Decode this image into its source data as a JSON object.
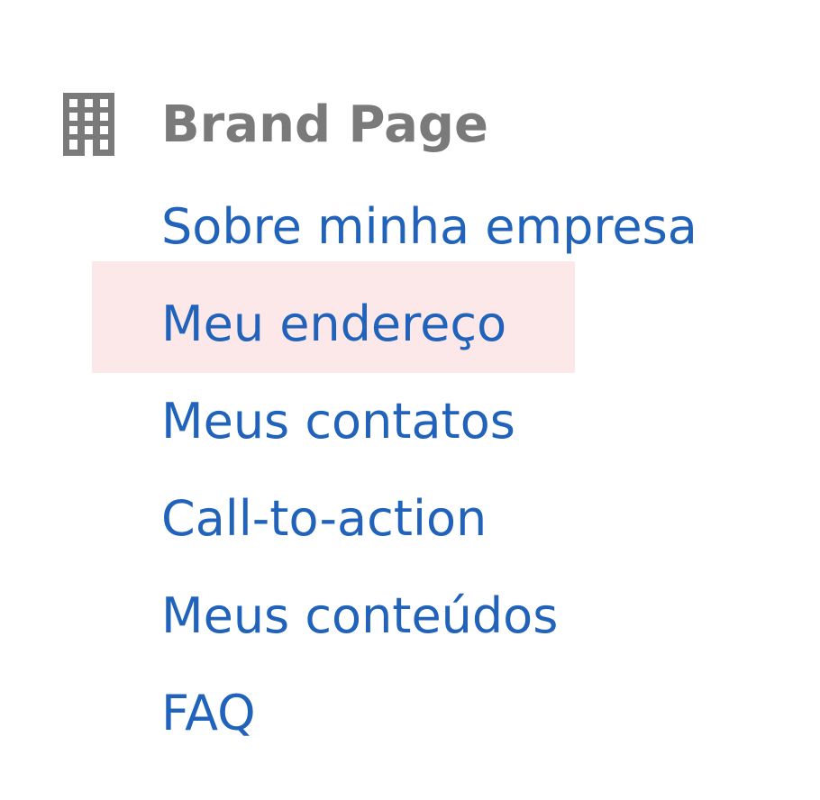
{
  "section": {
    "icon": "building-icon",
    "title": "Brand Page"
  },
  "nav": {
    "items": [
      {
        "label": "Sobre minha empresa",
        "active": false
      },
      {
        "label": "Meu endereço",
        "active": true
      },
      {
        "label": "Meus contatos",
        "active": false
      },
      {
        "label": "Call-to-action",
        "active": false
      },
      {
        "label": "Meus conteúdos",
        "active": false
      },
      {
        "label": "FAQ",
        "active": false
      }
    ]
  },
  "colors": {
    "title": "#7a7a7a",
    "link": "#2163bb",
    "highlight": "#fce8e8",
    "icon": "#7a7a7a"
  }
}
